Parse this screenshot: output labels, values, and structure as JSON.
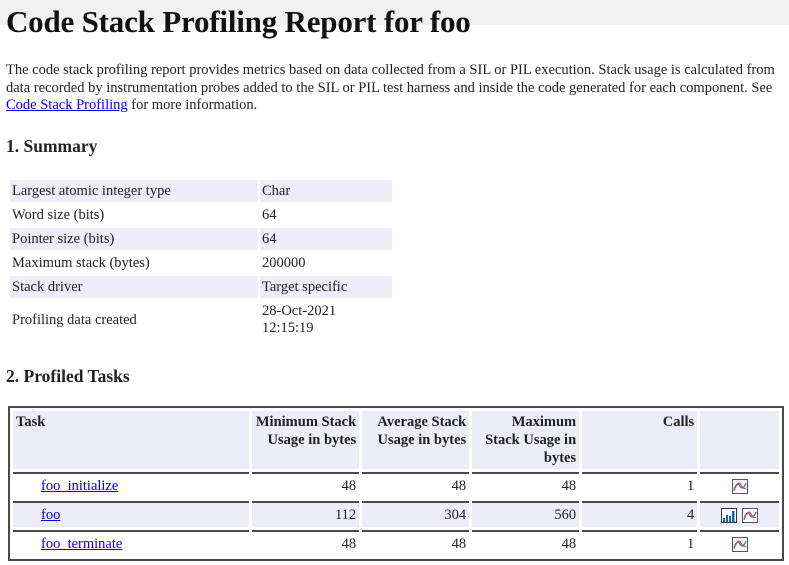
{
  "page": {
    "title": "Code Stack Profiling Report for foo",
    "intro": {
      "text_before_link": "The code stack profiling report provides metrics based on data collected from a SIL or PIL execution. Stack usage is calculated from data recorded by instrumentation probes added to the SIL or PIL test harness and inside the code generated for each component. See ",
      "link_label": "Code Stack Profiling",
      "text_after_link": " for more information."
    }
  },
  "summary": {
    "heading": "1. Summary",
    "rows": [
      {
        "label": "Largest atomic integer type",
        "value": "Char"
      },
      {
        "label": "Word size (bits)",
        "value": "64"
      },
      {
        "label": "Pointer size (bits)",
        "value": "64"
      },
      {
        "label": "Maximum stack (bytes)",
        "value": "200000"
      },
      {
        "label": "Stack driver",
        "value": "Target specific"
      },
      {
        "label": "Profiling data created",
        "value": "28-Oct-2021 12:15:19"
      }
    ]
  },
  "tasks": {
    "heading": "2. Profiled Tasks",
    "columns": {
      "task": "Task",
      "min": "Minimum Stack Usage in bytes",
      "avg": "Average Stack Usage in bytes",
      "max": "Maximum Stack Usage in bytes",
      "calls": "Calls",
      "actions": ""
    },
    "rows": [
      {
        "name": "foo_initialize",
        "min": "48",
        "avg": "48",
        "max": "48",
        "calls": "1",
        "icons": [
          "plot-icon"
        ]
      },
      {
        "name": "foo",
        "min": "112",
        "avg": "304",
        "max": "560",
        "calls": "4",
        "icons": [
          "histogram-icon",
          "plot-icon"
        ]
      },
      {
        "name": "foo_terminate",
        "min": "48",
        "avg": "48",
        "max": "48",
        "calls": "1",
        "icons": [
          "plot-icon"
        ]
      }
    ]
  },
  "colors": {
    "link": "#0000ee",
    "row_shade": "#ededfa",
    "top_bar": "#f0f0f0",
    "table_border": "#4a4a4a"
  }
}
